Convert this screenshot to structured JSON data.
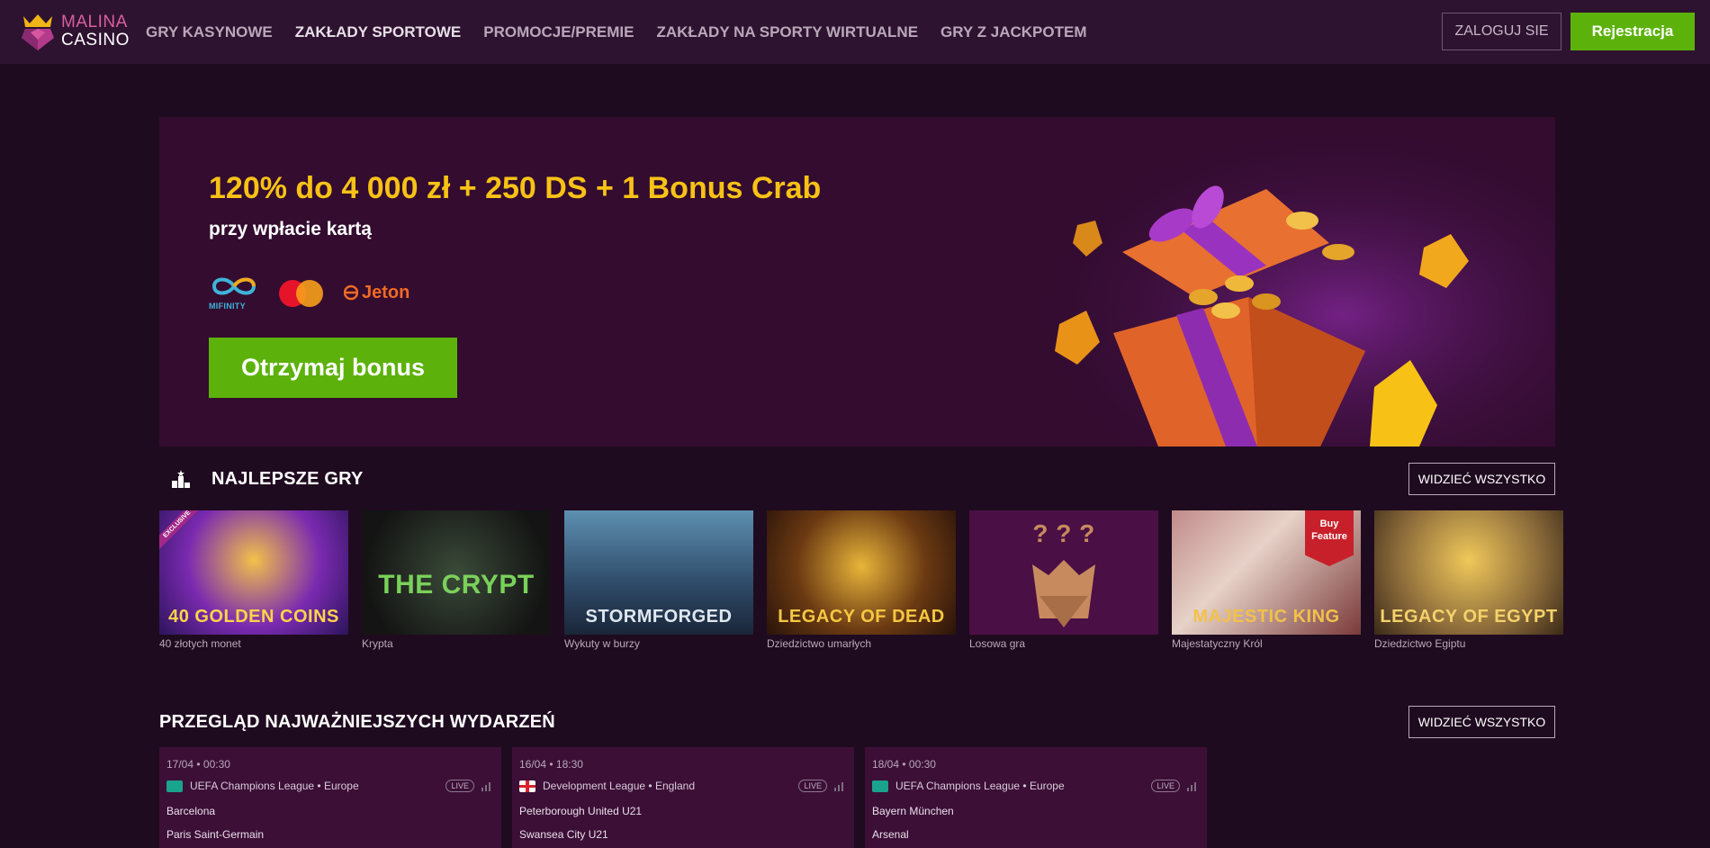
{
  "header": {
    "logo_line1": "MALINA",
    "logo_line2": "CASINO",
    "nav": [
      {
        "label": "GRY KASYNOWE",
        "active": false
      },
      {
        "label": "ZAKŁADY SPORTOWE",
        "active": true
      },
      {
        "label": "PROMOCJE/PREMIE",
        "active": false
      },
      {
        "label": "ZAKŁADY NA SPORTY WIRTUALNE",
        "active": false
      },
      {
        "label": "GRY Z JACKPOTEM",
        "active": false
      }
    ],
    "login_label": "ZALOGUJ SIE",
    "register_label": "Rejestracja"
  },
  "banner": {
    "title": "120% do 4 000 zł + 250 DS + 1 Bonus Crab",
    "subtitle": "przy wpłacie kartą",
    "payments": {
      "mifinity": "MIFINITY",
      "jeton": "Jeton"
    },
    "cta_label": "Otrzymaj bonus"
  },
  "top_games": {
    "title": "NAJLEPSZE GRY",
    "see_all_label": "WIDZIEĆ WSZYSTKO",
    "games": [
      {
        "name": "40 złotych monet",
        "thumb_title": "40 GOLDEN COINS",
        "badge": "EXCLUSIVE"
      },
      {
        "name": "Krypta",
        "thumb_title": "THE CRYPT"
      },
      {
        "name": "Wykuty w burzy",
        "thumb_title": "STORMFORGED"
      },
      {
        "name": "Dziedzictwo umarłych",
        "thumb_title": "LEGACY OF DEAD"
      },
      {
        "name": "Losowa gra",
        "thumb_title": "? ? ?"
      },
      {
        "name": "Majestatyczny Król",
        "thumb_title": "MAJESTIC KING",
        "badge": "Buy Feature"
      },
      {
        "name": "Dziedzictwo Egiptu",
        "thumb_title": "LEGACY OF EGYPT"
      }
    ]
  },
  "events_section": {
    "title": "PRZEGLĄD NAJWAŻNIEJSZYCH WYDARZEŃ",
    "see_all_label": "WIDZIEĆ WSZYSTKO",
    "events": [
      {
        "date": "17/04 • 00:30",
        "league": "UEFA Champions League • Europe",
        "live": "LIVE",
        "home": "Barcelona",
        "away": "Paris Saint-Germain"
      },
      {
        "date": "16/04 • 18:30",
        "league": "Development League • England",
        "live": "LIVE",
        "home": "Peterborough United U21",
        "away": "Swansea City U21"
      },
      {
        "date": "18/04 • 00:30",
        "league": "UEFA Champions League • Europe",
        "live": "LIVE",
        "home": "Bayern München",
        "away": "Arsenal"
      }
    ]
  },
  "colors": {
    "page_bg": "#1f0b1f",
    "header_bg": "#2e1330",
    "accent_green": "#5cb20b",
    "title_gold": "#f7c215",
    "card_bg": "#3c0f37"
  }
}
